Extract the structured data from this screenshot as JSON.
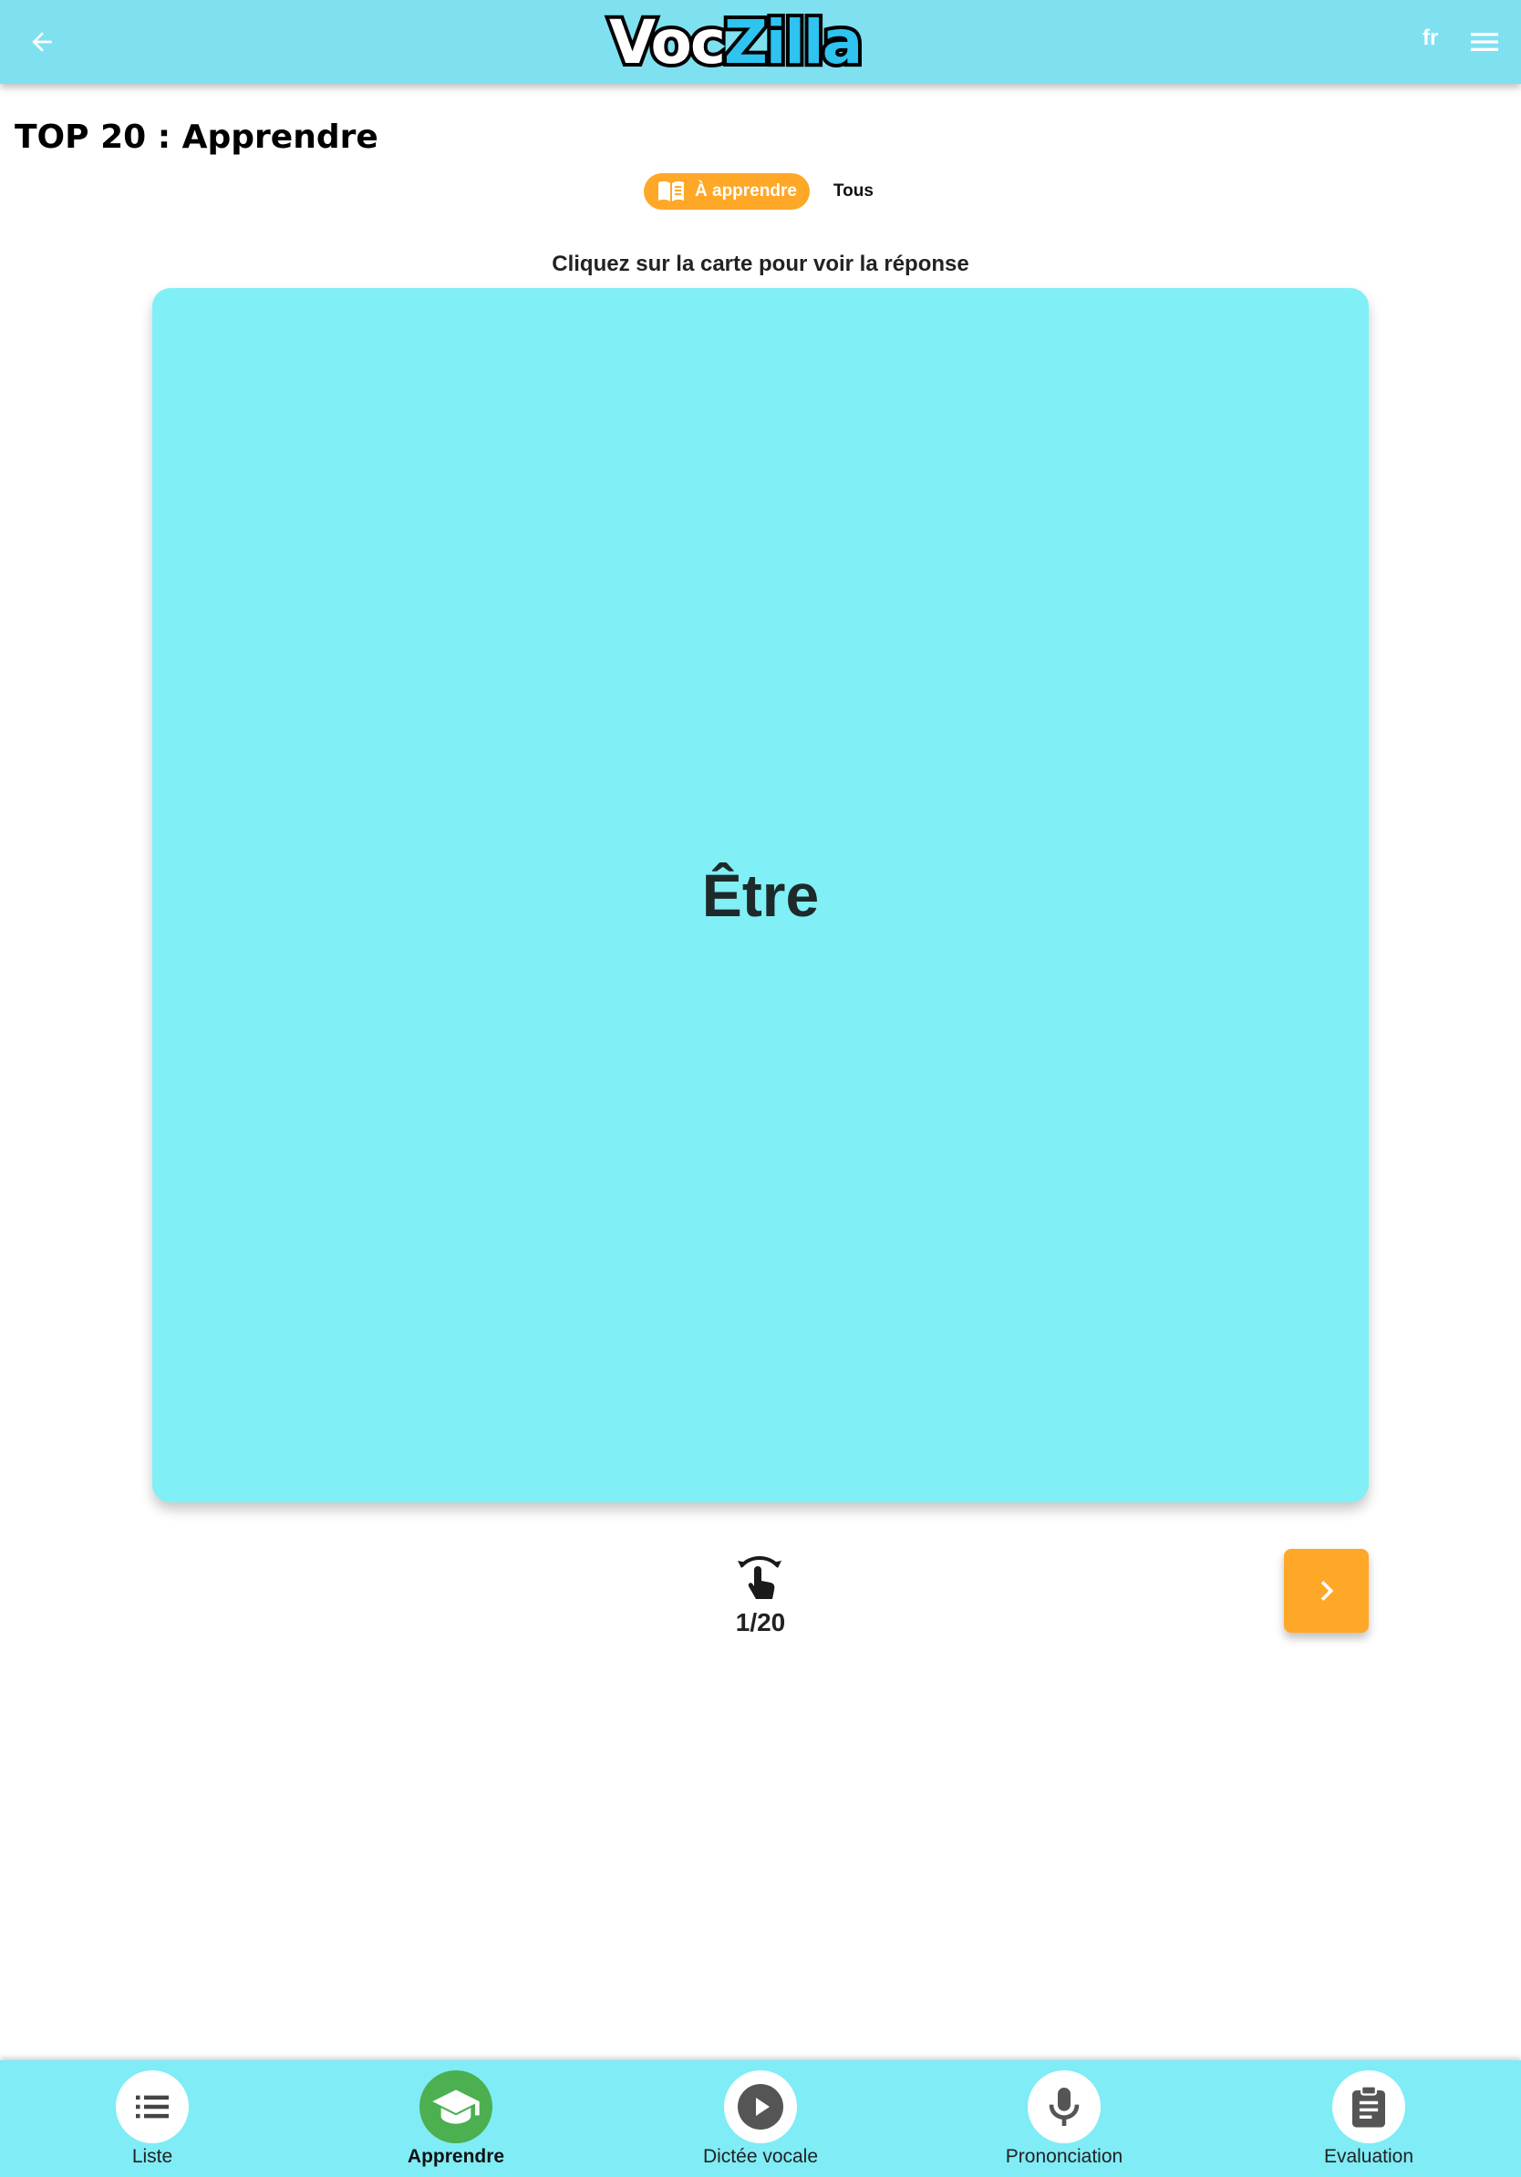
{
  "header": {
    "logo_part1": "Voc",
    "logo_part2": "Zilla",
    "language": "fr",
    "back_icon": "arrow-left-icon",
    "menu_icon": "hamburger-menu-icon"
  },
  "page": {
    "title": "TOP 20 : Apprendre",
    "hint": "Cliquez sur la carte pour voir la réponse"
  },
  "filters": {
    "active_label": "À apprendre",
    "active_icon": "open-book-icon",
    "other_label": "Tous"
  },
  "card": {
    "word": "Être"
  },
  "progress": {
    "counter": "1/20",
    "current": 1,
    "total": 20,
    "flip_icon": "tap-flip-icon",
    "next_icon": "chevron-right-icon"
  },
  "bottom_nav": {
    "items": [
      {
        "label": "Liste",
        "icon": "list-icon",
        "active": false
      },
      {
        "label": "Apprendre",
        "icon": "graduation-cap-icon",
        "active": true
      },
      {
        "label": "Dictée vocale",
        "icon": "play-circle-icon",
        "active": false
      },
      {
        "label": "Prononciation",
        "icon": "microphone-icon",
        "active": false
      },
      {
        "label": "Evaluation",
        "icon": "clipboard-icon",
        "active": false
      }
    ]
  },
  "colors": {
    "header_bg": "#7fe0f0",
    "card_bg": "#80eff6",
    "accent_orange": "#ffa726",
    "active_green": "#4caf50",
    "nav_bg": "#7fecf6"
  }
}
